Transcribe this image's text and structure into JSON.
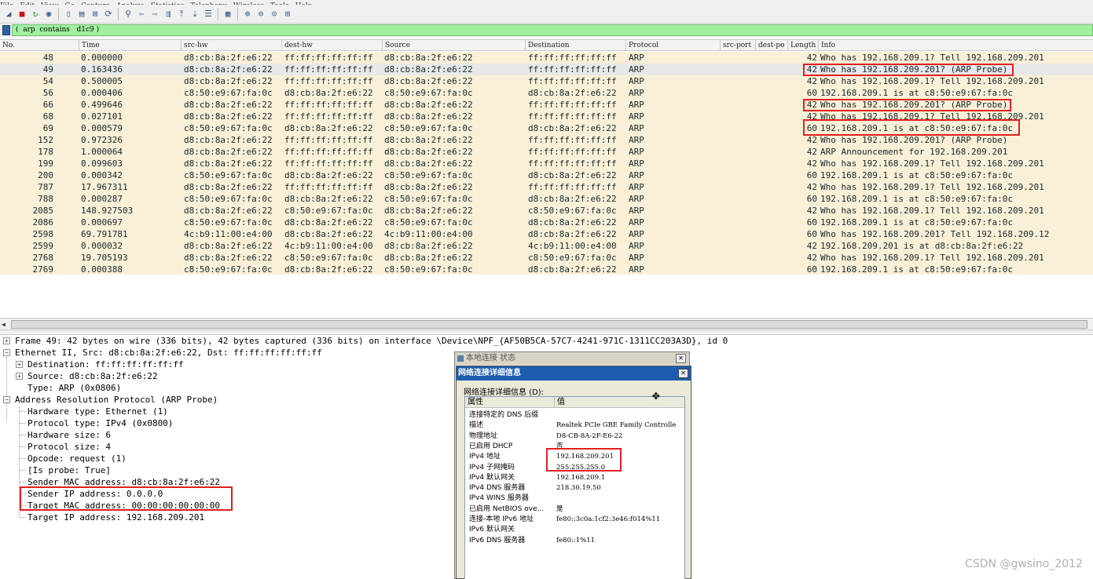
{
  "menu": [
    "File",
    "Edit",
    "View",
    "Go",
    "Capture",
    "Analyze",
    "Statistics",
    "Telephony",
    "Wireless",
    "Tools",
    "Help"
  ],
  "toolbar_icons": [
    "shark-fin-icon",
    "stop-capture-icon",
    "restart-capture-icon",
    "capture-options-icon",
    "open-file-icon",
    "save-file-icon",
    "close-file-icon",
    "reload-icon",
    "find-packet-icon",
    "go-back-icon",
    "go-forward-icon",
    "go-to-packet-icon",
    "go-first-icon",
    "go-last-icon",
    "autoscroll-icon",
    "colorize-icon",
    "zoom-in-icon",
    "zoom-out-icon",
    "zoom-normal-icon",
    "resize-columns-icon"
  ],
  "filter": {
    "text": "(  arp  contains   d1c9 )",
    "background": "#a0f0a0"
  },
  "columns": [
    "No.",
    "Time",
    "src-hw",
    "dest-hw",
    "Source",
    "Destination",
    "Protocol",
    "src-port",
    "dest-po",
    "Length",
    "Info"
  ],
  "packets": [
    {
      "no": "48",
      "time": "0.000000",
      "src_hw": "d8:cb:8a:2f:e6:22",
      "dest_hw": "ff:ff:ff:ff:ff:ff",
      "source": "d8:cb:8a:2f:e6:22",
      "destination": "ff:ff:ff:ff:ff:ff",
      "protocol": "ARP",
      "length": "42",
      "info": "Who has 192.168.209.1? Tell 192.168.209.201"
    },
    {
      "no": "49",
      "time": "0.163436",
      "src_hw": "d8:cb:8a:2f:e6:22",
      "dest_hw": "ff:ff:ff:ff:ff:ff",
      "source": "d8:cb:8a:2f:e6:22",
      "destination": "ff:ff:ff:ff:ff:ff",
      "protocol": "ARP",
      "length": "42",
      "info": "Who has 192.168.209.201? (ARP Probe)"
    },
    {
      "no": "54",
      "time": "0.500005",
      "src_hw": "d8:cb:8a:2f:e6:22",
      "dest_hw": "ff:ff:ff:ff:ff:ff",
      "source": "d8:cb:8a:2f:e6:22",
      "destination": "ff:ff:ff:ff:ff:ff",
      "protocol": "ARP",
      "length": "42",
      "info": "Who has 192.168.209.1? Tell 192.168.209.201"
    },
    {
      "no": "56",
      "time": "0.000406",
      "src_hw": "c8:50:e9:67:fa:0c",
      "dest_hw": "d8:cb:8a:2f:e6:22",
      "source": "c8:50:e9:67:fa:0c",
      "destination": "d8:cb:8a:2f:e6:22",
      "protocol": "ARP",
      "length": "60",
      "info": "192.168.209.1 is at c8:50:e9:67:fa:0c"
    },
    {
      "no": "66",
      "time": "0.499646",
      "src_hw": "d8:cb:8a:2f:e6:22",
      "dest_hw": "ff:ff:ff:ff:ff:ff",
      "source": "d8:cb:8a:2f:e6:22",
      "destination": "ff:ff:ff:ff:ff:ff",
      "protocol": "ARP",
      "length": "42",
      "info": "Who has 192.168.209.201? (ARP Probe)"
    },
    {
      "no": "68",
      "time": "0.027101",
      "src_hw": "d8:cb:8a:2f:e6:22",
      "dest_hw": "ff:ff:ff:ff:ff:ff",
      "source": "d8:cb:8a:2f:e6:22",
      "destination": "ff:ff:ff:ff:ff:ff",
      "protocol": "ARP",
      "length": "42",
      "info": "Who has 192.168.209.1? Tell 192.168.209.201"
    },
    {
      "no": "69",
      "time": "0.000579",
      "src_hw": "c8:50:e9:67:fa:0c",
      "dest_hw": "d8:cb:8a:2f:e6:22",
      "source": "c8:50:e9:67:fa:0c",
      "destination": "d8:cb:8a:2f:e6:22",
      "protocol": "ARP",
      "length": "60",
      "info": "192.168.209.1 is at c8:50:e9:67:fa:0c"
    },
    {
      "no": "152",
      "time": "0.972326",
      "src_hw": "d8:cb:8a:2f:e6:22",
      "dest_hw": "ff:ff:ff:ff:ff:ff",
      "source": "d8:cb:8a:2f:e6:22",
      "destination": "ff:ff:ff:ff:ff:ff",
      "protocol": "ARP",
      "length": "42",
      "info": "Who has 192.168.209.201? (ARP Probe)"
    },
    {
      "no": "178",
      "time": "1.000064",
      "src_hw": "d8:cb:8a:2f:e6:22",
      "dest_hw": "ff:ff:ff:ff:ff:ff",
      "source": "d8:cb:8a:2f:e6:22",
      "destination": "ff:ff:ff:ff:ff:ff",
      "protocol": "ARP",
      "length": "42",
      "info": "ARP Announcement for 192.168.209.201"
    },
    {
      "no": "199",
      "time": "0.099603",
      "src_hw": "d8:cb:8a:2f:e6:22",
      "dest_hw": "ff:ff:ff:ff:ff:ff",
      "source": "d8:cb:8a:2f:e6:22",
      "destination": "ff:ff:ff:ff:ff:ff",
      "protocol": "ARP",
      "length": "42",
      "info": "Who has 192.168.209.1? Tell 192.168.209.201"
    },
    {
      "no": "200",
      "time": "0.000342",
      "src_hw": "c8:50:e9:67:fa:0c",
      "dest_hw": "d8:cb:8a:2f:e6:22",
      "source": "c8:50:e9:67:fa:0c",
      "destination": "d8:cb:8a:2f:e6:22",
      "protocol": "ARP",
      "length": "60",
      "info": "192.168.209.1 is at c8:50:e9:67:fa:0c"
    },
    {
      "no": "787",
      "time": "17.967311",
      "src_hw": "d8:cb:8a:2f:e6:22",
      "dest_hw": "ff:ff:ff:ff:ff:ff",
      "source": "d8:cb:8a:2f:e6:22",
      "destination": "ff:ff:ff:ff:ff:ff",
      "protocol": "ARP",
      "length": "42",
      "info": "Who has 192.168.209.1? Tell 192.168.209.201"
    },
    {
      "no": "788",
      "time": "0.000287",
      "src_hw": "c8:50:e9:67:fa:0c",
      "dest_hw": "d8:cb:8a:2f:e6:22",
      "source": "c8:50:e9:67:fa:0c",
      "destination": "d8:cb:8a:2f:e6:22",
      "protocol": "ARP",
      "length": "60",
      "info": "192.168.209.1 is at c8:50:e9:67:fa:0c"
    },
    {
      "no": "2085",
      "time": "148.927503",
      "src_hw": "d8:cb:8a:2f:e6:22",
      "dest_hw": "c8:50:e9:67:fa:0c",
      "source": "d8:cb:8a:2f:e6:22",
      "destination": "c8:50:e9:67:fa:0c",
      "protocol": "ARP",
      "length": "42",
      "info": "Who has 192.168.209.1? Tell 192.168.209.201"
    },
    {
      "no": "2086",
      "time": "0.000697",
      "src_hw": "c8:50:e9:67:fa:0c",
      "dest_hw": "d8:cb:8a:2f:e6:22",
      "source": "c8:50:e9:67:fa:0c",
      "destination": "d8:cb:8a:2f:e6:22",
      "protocol": "ARP",
      "length": "60",
      "info": "192.168.209.1 is at c8:50:e9:67:fa:0c"
    },
    {
      "no": "2598",
      "time": "69.791781",
      "src_hw": "4c:b9:11:00:e4:00",
      "dest_hw": "d8:cb:8a:2f:e6:22",
      "source": "4c:b9:11:00:e4:00",
      "destination": "d8:cb:8a:2f:e6:22",
      "protocol": "ARP",
      "length": "60",
      "info": "Who has 192.168.209.201? Tell 192.168.209.12"
    },
    {
      "no": "2599",
      "time": "0.000032",
      "src_hw": "d8:cb:8a:2f:e6:22",
      "dest_hw": "4c:b9:11:00:e4:00",
      "source": "d8:cb:8a:2f:e6:22",
      "destination": "4c:b9:11:00:e4:00",
      "protocol": "ARP",
      "length": "42",
      "info": "192.168.209.201 is at d8:cb:8a:2f:e6:22"
    },
    {
      "no": "2768",
      "time": "19.705193",
      "src_hw": "d8:cb:8a:2f:e6:22",
      "dest_hw": "c8:50:e9:67:fa:0c",
      "source": "d8:cb:8a:2f:e6:22",
      "destination": "c8:50:e9:67:fa:0c",
      "protocol": "ARP",
      "length": "42",
      "info": "Who has 192.168.209.1? Tell 192.168.209.201"
    },
    {
      "no": "2769",
      "time": "0.000388",
      "src_hw": "c8:50:e9:67:fa:0c",
      "dest_hw": "d8:cb:8a:2f:e6:22",
      "source": "c8:50:e9:67:fa:0c",
      "destination": "d8:cb:8a:2f:e6:22",
      "protocol": "ARP",
      "length": "60",
      "info": "192.168.209.1 is at c8:50:e9:67:fa:0c"
    }
  ],
  "selected_packet_no": "49",
  "highlighted_packet_nos": [
    "49",
    "66",
    "69"
  ],
  "details": {
    "frame": "Frame 49: 42 bytes on wire (336 bits), 42 bytes captured (336 bits) on interface \\Device\\NPF_{AF50B5CA-57C7-4241-971C-1311CC203A3D}, id 0",
    "ethernet": "Ethernet II, Src: d8:cb:8a:2f:e6:22, Dst: ff:ff:ff:ff:ff:ff",
    "eth_destination": "Destination: ff:ff:ff:ff:ff:ff",
    "eth_source": "Source: d8:cb:8a:2f:e6:22",
    "eth_type": "Type: ARP (0x0806)",
    "arp": "Address Resolution Protocol (ARP Probe)",
    "arp_fields": [
      "Hardware type: Ethernet (1)",
      "Protocol type: IPv4 (0x0800)",
      "Hardware size: 6",
      "Protocol size: 4",
      "Opcode: request (1)",
      "[Is probe: True]",
      "Sender MAC address: d8:cb:8a:2f:e6:22",
      "Sender IP address: 0.0.0.0",
      "Target MAC address: 00:00:00:00:00:00",
      "Target IP address: 192.168.209.201"
    ]
  },
  "dialog_status": {
    "title": "本地连接 状态",
    "close": "✕"
  },
  "dialog_details": {
    "title": "网络连接详细信息",
    "close": "✕",
    "label": "网络连接详细信息 (D):",
    "col_property": "属性",
    "col_value": "值",
    "rows": [
      {
        "k": "连接特定的 DNS 后缀",
        "v": ""
      },
      {
        "k": "描述",
        "v": "Realtek PCIe GBE Family Controlle"
      },
      {
        "k": "物理地址",
        "v": "D8-CB-8A-2F-E6-22"
      },
      {
        "k": "已启用 DHCP",
        "v": "否"
      },
      {
        "k": "IPv4 地址",
        "v": "192.168.209.201"
      },
      {
        "k": "IPv4 子网掩码",
        "v": "255.255.255.0"
      },
      {
        "k": "IPv4 默认网关",
        "v": "192.168.209.1"
      },
      {
        "k": "IPv4 DNS 服务器",
        "v": "218.30.19.50"
      },
      {
        "k": "IPv4 WINS 服务器",
        "v": ""
      },
      {
        "k": "已启用 NetBIOS ove...",
        "v": "是"
      },
      {
        "k": "连接-本地 IPv6 地址",
        "v": "fe80::3c0a:1cf2:3e46:f014%11"
      },
      {
        "k": "IPv6 默认网关",
        "v": ""
      },
      {
        "k": "IPv6 DNS 服务器",
        "v": "fe80::1%11"
      }
    ]
  },
  "watermark": "CSDN @gwsino_2012",
  "colors": {
    "row_bg": "#faf0d7",
    "selected_row_bg": "#e8e8e8",
    "highlight_box": "#e02020",
    "dialog_title_bg": "#1c5db0"
  }
}
